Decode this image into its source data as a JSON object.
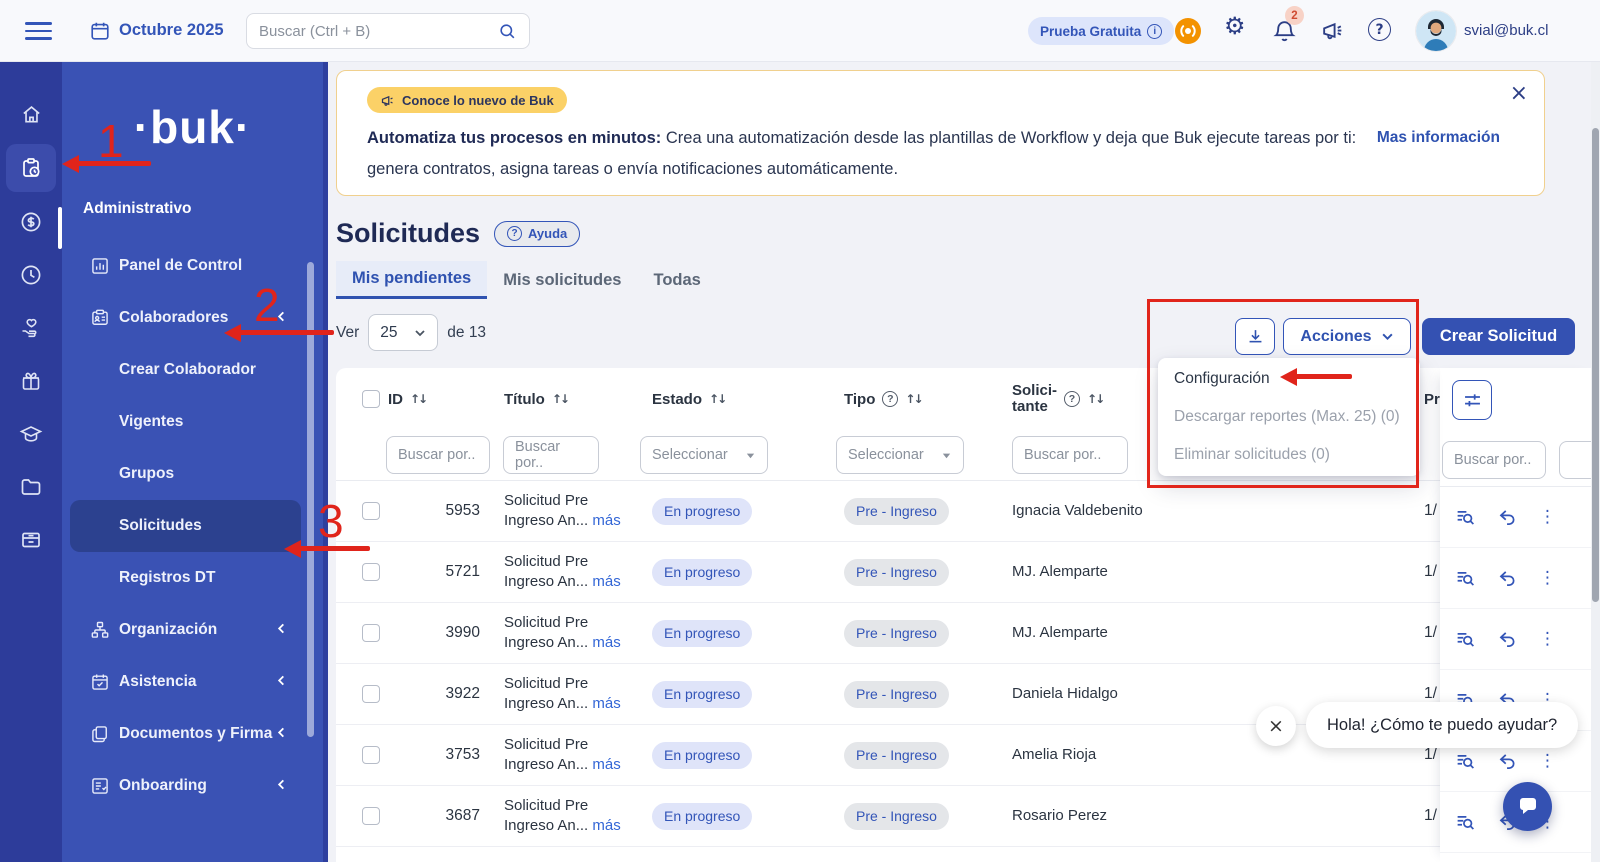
{
  "palette": {
    "accent": "#3355b8",
    "primary_button": "#3451b2",
    "rail": "#2d3c9a",
    "sidebar": "#3a52b4",
    "annotation_red": "#e0241b",
    "estado_badge_bg": "#dfe4f9",
    "tipo_badge_bg": "#e4e6e9",
    "banner_pill_bg": "#fbd167",
    "trial_pill_bg": "#dde5fb"
  },
  "topbar": {
    "date": "Octubre 2025",
    "search_placeholder": "Buscar (Ctrl + B)",
    "trial_badge": "Prueba Gratuita",
    "notification_count": "2",
    "user_email": "svial@buk.cl"
  },
  "sidebar": {
    "logo": "·buk·",
    "section": "Administrativo",
    "items": [
      {
        "label": "Panel de Control"
      },
      {
        "label": "Colaboradores"
      },
      {
        "label": "Crear Colaborador"
      },
      {
        "label": "Vigentes"
      },
      {
        "label": "Grupos"
      },
      {
        "label": "Solicitudes"
      },
      {
        "label": "Registros DT"
      },
      {
        "label": "Organización"
      },
      {
        "label": "Asistencia"
      },
      {
        "label": "Documentos y Firma"
      },
      {
        "label": "Onboarding"
      }
    ]
  },
  "banner": {
    "tag": "Conoce lo nuevo de Buk",
    "bold": "Automatiza tus procesos en minutos:",
    "text": " Crea una automatización desde las plantillas de Workflow y deja que Buk ejecute tareas por ti: genera contratos, asigna tareas o envía notificaciones automáticamente.",
    "link": "Mas información",
    "close": "×"
  },
  "page": {
    "title": "Solicitudes",
    "help": "Ayuda",
    "tabs": [
      "Mis pendientes",
      "Mis solicitudes",
      "Todas"
    ],
    "ver": "Ver",
    "per_page": "25",
    "total": "de 13"
  },
  "actions": {
    "acciones": "Acciones",
    "crear": "Crear Solicitud",
    "menu": [
      "Configuración",
      "Descargar reportes (Max. 25) (0)",
      "Eliminar solicitudes (0)"
    ]
  },
  "table": {
    "headers": {
      "id": "ID",
      "titulo": "Título",
      "estado": "Estado",
      "tipo": "Tipo",
      "solicitante_1": "Solici-",
      "solicitante_2": "tante",
      "pr": "Pr"
    },
    "filters": {
      "search_placeholder": "Buscar por..",
      "select_placeholder": "Seleccionar"
    },
    "more_label": "más",
    "rows": [
      {
        "id": "5953",
        "t1": "Solicitud Pre",
        "t2": "Ingreso An...",
        "estado": "En progreso",
        "tipo": "Pre - Ingreso",
        "solicitante": "Ignacia Valdebenito",
        "progress": "1/"
      },
      {
        "id": "5721",
        "t1": "Solicitud Pre",
        "t2": "Ingreso An...",
        "estado": "En progreso",
        "tipo": "Pre - Ingreso",
        "solicitante": "MJ. Alemparte",
        "progress": "1/"
      },
      {
        "id": "3990",
        "t1": "Solicitud Pre",
        "t2": "Ingreso An...",
        "estado": "En progreso",
        "tipo": "Pre - Ingreso",
        "solicitante": "MJ. Alemparte",
        "progress": "1/"
      },
      {
        "id": "3922",
        "t1": "Solicitud Pre",
        "t2": "Ingreso An...",
        "estado": "En progreso",
        "tipo": "Pre - Ingreso",
        "solicitante": "Daniela Hidalgo",
        "progress": "1/"
      },
      {
        "id": "3753",
        "t1": "Solicitud Pre",
        "t2": "Ingreso An...",
        "estado": "En progreso",
        "tipo": "Pre - Ingreso",
        "solicitante": "Amelia Rioja",
        "progress": "1/"
      },
      {
        "id": "3687",
        "t1": "Solicitud Pre",
        "t2": "Ingreso An...",
        "estado": "En progreso",
        "tipo": "Pre - Ingreso",
        "solicitante": "Rosario Perez",
        "progress": "1/"
      }
    ]
  },
  "chat": {
    "message": "Hola! ¿Cómo te puedo ayudar?",
    "close": "×"
  },
  "annotations": {
    "n1": "1",
    "n2": "2",
    "n3": "3"
  },
  "glyphs": {
    "gear": "⚙",
    "dots": "⋮",
    "sort": "↑↓",
    "close": "×",
    "question": "?"
  }
}
